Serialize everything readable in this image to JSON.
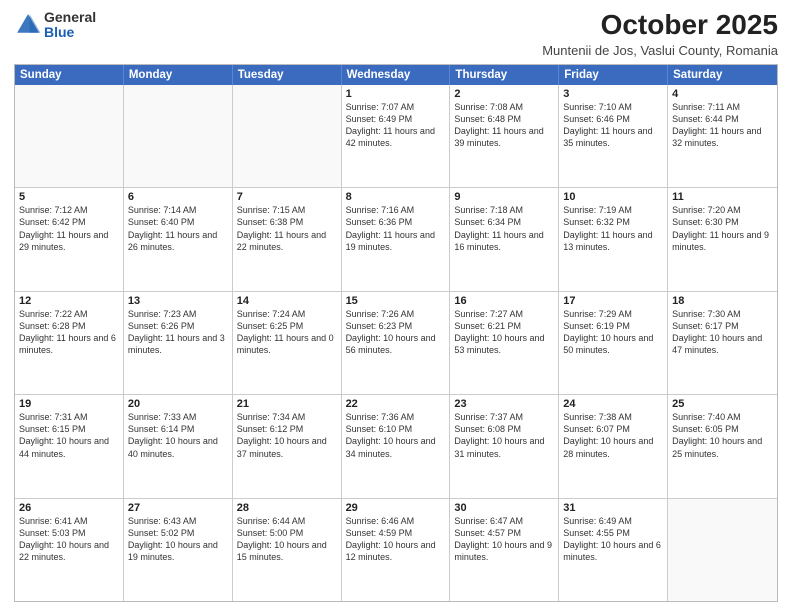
{
  "logo": {
    "general": "General",
    "blue": "Blue"
  },
  "title": "October 2025",
  "location": "Muntenii de Jos, Vaslui County, Romania",
  "days_of_week": [
    "Sunday",
    "Monday",
    "Tuesday",
    "Wednesday",
    "Thursday",
    "Friday",
    "Saturday"
  ],
  "weeks": [
    [
      {
        "day": "",
        "content": ""
      },
      {
        "day": "",
        "content": ""
      },
      {
        "day": "",
        "content": ""
      },
      {
        "day": "1",
        "content": "Sunrise: 7:07 AM\nSunset: 6:49 PM\nDaylight: 11 hours and 42 minutes."
      },
      {
        "day": "2",
        "content": "Sunrise: 7:08 AM\nSunset: 6:48 PM\nDaylight: 11 hours and 39 minutes."
      },
      {
        "day": "3",
        "content": "Sunrise: 7:10 AM\nSunset: 6:46 PM\nDaylight: 11 hours and 35 minutes."
      },
      {
        "day": "4",
        "content": "Sunrise: 7:11 AM\nSunset: 6:44 PM\nDaylight: 11 hours and 32 minutes."
      }
    ],
    [
      {
        "day": "5",
        "content": "Sunrise: 7:12 AM\nSunset: 6:42 PM\nDaylight: 11 hours and 29 minutes."
      },
      {
        "day": "6",
        "content": "Sunrise: 7:14 AM\nSunset: 6:40 PM\nDaylight: 11 hours and 26 minutes."
      },
      {
        "day": "7",
        "content": "Sunrise: 7:15 AM\nSunset: 6:38 PM\nDaylight: 11 hours and 22 minutes."
      },
      {
        "day": "8",
        "content": "Sunrise: 7:16 AM\nSunset: 6:36 PM\nDaylight: 11 hours and 19 minutes."
      },
      {
        "day": "9",
        "content": "Sunrise: 7:18 AM\nSunset: 6:34 PM\nDaylight: 11 hours and 16 minutes."
      },
      {
        "day": "10",
        "content": "Sunrise: 7:19 AM\nSunset: 6:32 PM\nDaylight: 11 hours and 13 minutes."
      },
      {
        "day": "11",
        "content": "Sunrise: 7:20 AM\nSunset: 6:30 PM\nDaylight: 11 hours and 9 minutes."
      }
    ],
    [
      {
        "day": "12",
        "content": "Sunrise: 7:22 AM\nSunset: 6:28 PM\nDaylight: 11 hours and 6 minutes."
      },
      {
        "day": "13",
        "content": "Sunrise: 7:23 AM\nSunset: 6:26 PM\nDaylight: 11 hours and 3 minutes."
      },
      {
        "day": "14",
        "content": "Sunrise: 7:24 AM\nSunset: 6:25 PM\nDaylight: 11 hours and 0 minutes."
      },
      {
        "day": "15",
        "content": "Sunrise: 7:26 AM\nSunset: 6:23 PM\nDaylight: 10 hours and 56 minutes."
      },
      {
        "day": "16",
        "content": "Sunrise: 7:27 AM\nSunset: 6:21 PM\nDaylight: 10 hours and 53 minutes."
      },
      {
        "day": "17",
        "content": "Sunrise: 7:29 AM\nSunset: 6:19 PM\nDaylight: 10 hours and 50 minutes."
      },
      {
        "day": "18",
        "content": "Sunrise: 7:30 AM\nSunset: 6:17 PM\nDaylight: 10 hours and 47 minutes."
      }
    ],
    [
      {
        "day": "19",
        "content": "Sunrise: 7:31 AM\nSunset: 6:15 PM\nDaylight: 10 hours and 44 minutes."
      },
      {
        "day": "20",
        "content": "Sunrise: 7:33 AM\nSunset: 6:14 PM\nDaylight: 10 hours and 40 minutes."
      },
      {
        "day": "21",
        "content": "Sunrise: 7:34 AM\nSunset: 6:12 PM\nDaylight: 10 hours and 37 minutes."
      },
      {
        "day": "22",
        "content": "Sunrise: 7:36 AM\nSunset: 6:10 PM\nDaylight: 10 hours and 34 minutes."
      },
      {
        "day": "23",
        "content": "Sunrise: 7:37 AM\nSunset: 6:08 PM\nDaylight: 10 hours and 31 minutes."
      },
      {
        "day": "24",
        "content": "Sunrise: 7:38 AM\nSunset: 6:07 PM\nDaylight: 10 hours and 28 minutes."
      },
      {
        "day": "25",
        "content": "Sunrise: 7:40 AM\nSunset: 6:05 PM\nDaylight: 10 hours and 25 minutes."
      }
    ],
    [
      {
        "day": "26",
        "content": "Sunrise: 6:41 AM\nSunset: 5:03 PM\nDaylight: 10 hours and 22 minutes."
      },
      {
        "day": "27",
        "content": "Sunrise: 6:43 AM\nSunset: 5:02 PM\nDaylight: 10 hours and 19 minutes."
      },
      {
        "day": "28",
        "content": "Sunrise: 6:44 AM\nSunset: 5:00 PM\nDaylight: 10 hours and 15 minutes."
      },
      {
        "day": "29",
        "content": "Sunrise: 6:46 AM\nSunset: 4:59 PM\nDaylight: 10 hours and 12 minutes."
      },
      {
        "day": "30",
        "content": "Sunrise: 6:47 AM\nSunset: 4:57 PM\nDaylight: 10 hours and 9 minutes."
      },
      {
        "day": "31",
        "content": "Sunrise: 6:49 AM\nSunset: 4:55 PM\nDaylight: 10 hours and 6 minutes."
      },
      {
        "day": "",
        "content": ""
      }
    ]
  ]
}
